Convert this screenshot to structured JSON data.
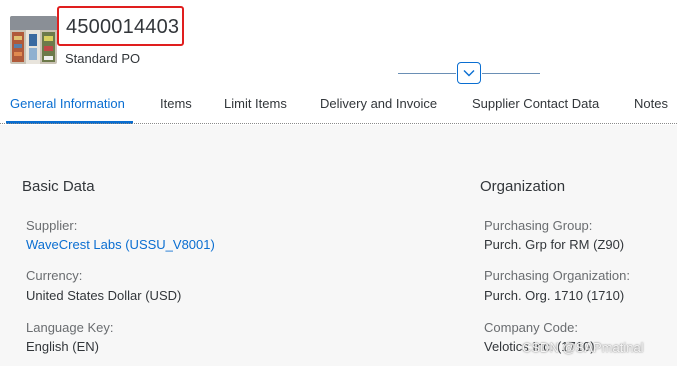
{
  "header": {
    "po_number": "4500014403",
    "po_type": "Standard PO",
    "collapse_icon": "chevron-down-icon"
  },
  "tabs": [
    {
      "label": "General Information",
      "active": true
    },
    {
      "label": "Items",
      "active": false
    },
    {
      "label": "Limit Items",
      "active": false
    },
    {
      "label": "Delivery and Invoice",
      "active": false
    },
    {
      "label": "Supplier Contact Data",
      "active": false
    },
    {
      "label": "Notes",
      "active": false
    }
  ],
  "basic_data": {
    "title": "Basic Data",
    "supplier_label": "Supplier:",
    "supplier_value": "WaveCrest Labs (USSU_V8001)",
    "currency_label": "Currency:",
    "currency_value": "United States Dollar (USD)",
    "language_label": "Language Key:",
    "language_value": "English (EN)"
  },
  "organization": {
    "title": "Organization",
    "purch_group_label": "Purchasing Group:",
    "purch_group_value": "Purch. Grp for RM (Z90)",
    "purch_org_label": "Purchasing Organization:",
    "purch_org_value": "Purch. Org. 1710 (1710)",
    "company_code_label": "Company Code:",
    "company_code_value": "Velotics Inc. (1710)"
  },
  "watermark": "CSDN @SAPmatinal",
  "colors": {
    "accent": "#0a6ed1",
    "highlight_border": "#e01e1e",
    "content_bg": "#f7f7f7"
  }
}
